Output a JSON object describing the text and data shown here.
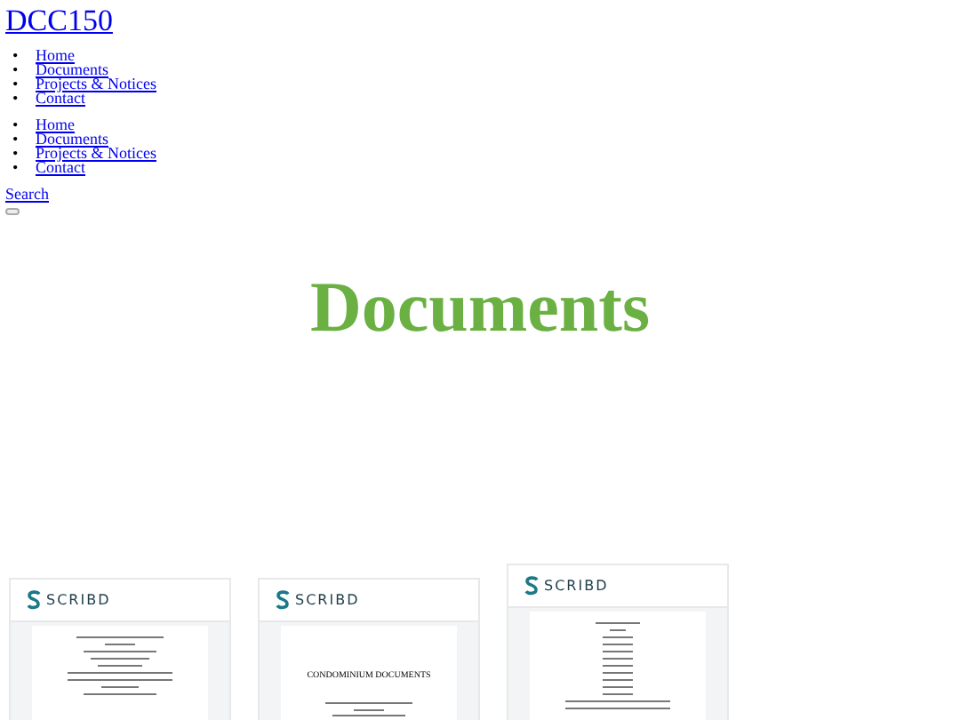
{
  "site_title": "DCC150",
  "menus": [
    {
      "items": [
        {
          "marker": "•",
          "label": "Home"
        },
        {
          "marker": "•",
          "label": "Documents"
        },
        {
          "marker": "•",
          "label": "Projects & Notices"
        },
        {
          "marker": "•",
          "label": "Contact"
        }
      ]
    },
    {
      "items": [
        {
          "marker": "•",
          "label": "Home"
        },
        {
          "marker": "•",
          "label": "Documents"
        },
        {
          "marker": "•",
          "label": "Projects & Notices"
        },
        {
          "marker": "•",
          "label": "Contact"
        }
      ]
    }
  ],
  "search_link": "Search",
  "page_heading": "Documents",
  "embeds": [
    {
      "brand": "SCRIBD"
    },
    {
      "brand": "SCRIBD",
      "document_title": "CONDOMINIUM DOCUMENTS"
    },
    {
      "brand": "SCRIBD"
    }
  ]
}
